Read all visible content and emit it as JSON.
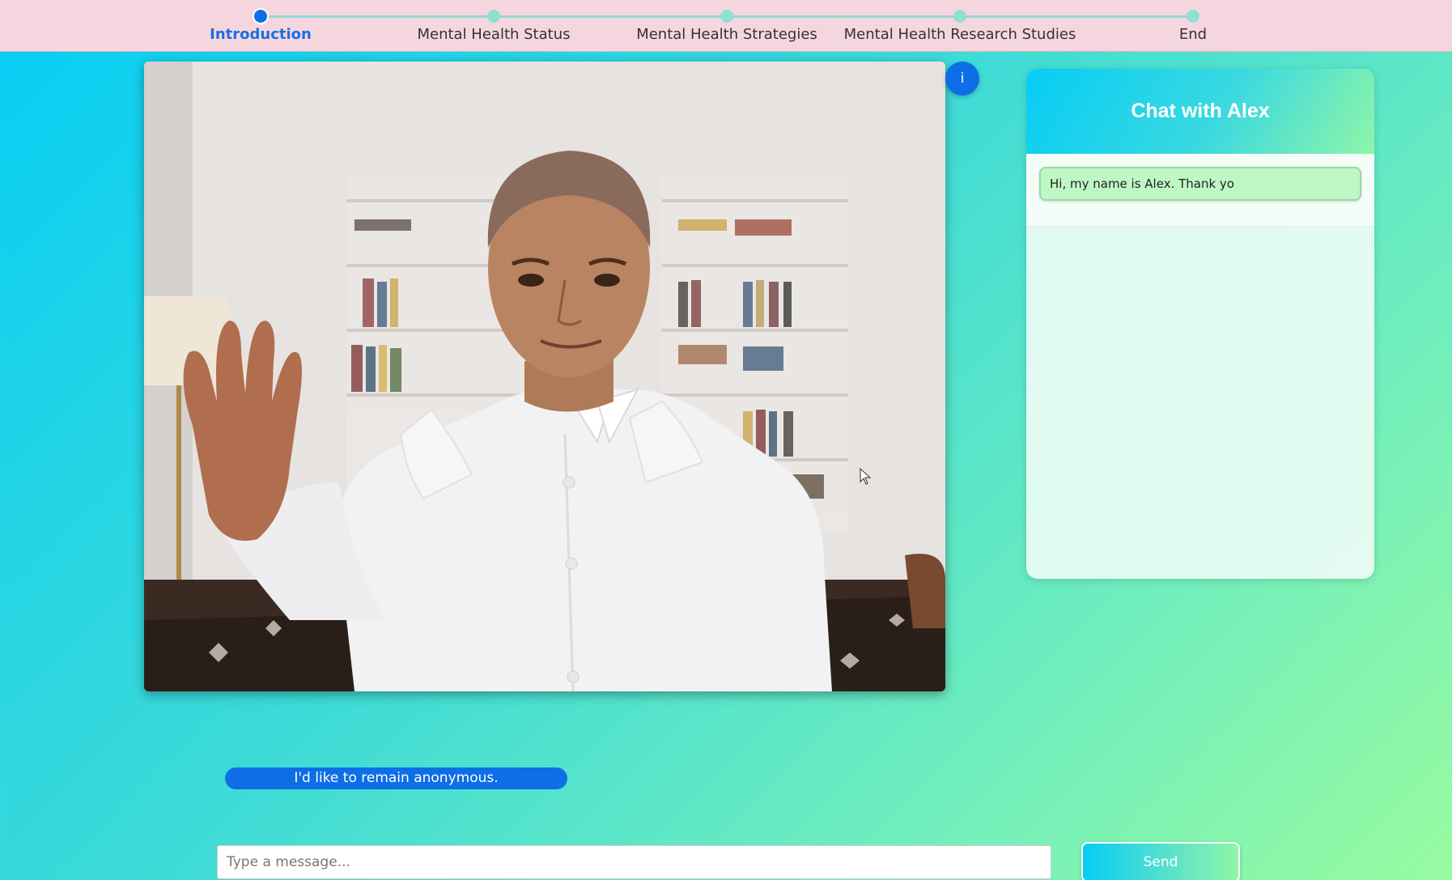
{
  "progress": {
    "steps": [
      {
        "label": "Introduction",
        "active": true
      },
      {
        "label": "Mental Health Status",
        "active": false
      },
      {
        "label": "Mental Health Strategies",
        "active": false
      },
      {
        "label": "Mental Health Research Studies",
        "active": false
      },
      {
        "label": "End",
        "active": false
      }
    ]
  },
  "video": {
    "info_label": "i"
  },
  "chat": {
    "title": "Chat with Alex",
    "messages": [
      "Hi, my name is Alex. Thank yo"
    ]
  },
  "suggestion": "I'd like to remain anonymous.",
  "composer": {
    "placeholder": "Type a message...",
    "send_label": "Send"
  },
  "colors": {
    "accent": "#0d6ee6",
    "topbar": "#f6d6de",
    "bubble": "#bff7c4"
  }
}
